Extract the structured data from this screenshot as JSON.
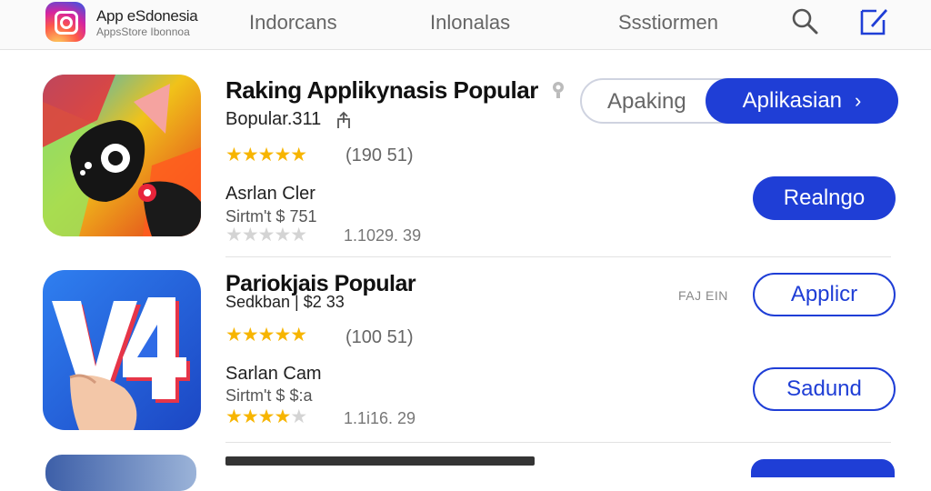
{
  "header": {
    "brand_title": "App eSdonesia",
    "brand_subtitle": "AppsStore Ibonnoa",
    "tabs": [
      "Indorcans",
      "Inlonalas",
      "Ssstiormen"
    ],
    "icons": [
      "search-icon",
      "edit-icon"
    ]
  },
  "rows": [
    {
      "title": "Raking Applikynasis Popular",
      "subtitle": "Bopular.311",
      "stars": "★★★★★",
      "rating_count": "(190 51)",
      "developer": "Asrlan Cler",
      "price": "Sirtm't $ 751",
      "secondary_stars": "★★★★★",
      "secondary_count": "1.1029. 39",
      "toggle": {
        "left": "Apaking",
        "right": "Aplikasian"
      },
      "button": "Realngo"
    },
    {
      "title": "Pariokjais  Popular",
      "subtitle": "Sedkban | $2 33",
      "tag": "FAJ EIN",
      "stars": "★★★★★",
      "rating_count": "(100 51)",
      "developer": "Sarlan Cam",
      "price": "Sirtm't $ $:a",
      "secondary_stars_on": "★★★★",
      "secondary_stars_off": "★",
      "secondary_count": "1.1i16. 29",
      "button_top": "Applicr",
      "button_bottom": "Sadund"
    }
  ],
  "colors": {
    "accent": "#1f3ed6",
    "star": "#f7b500"
  }
}
